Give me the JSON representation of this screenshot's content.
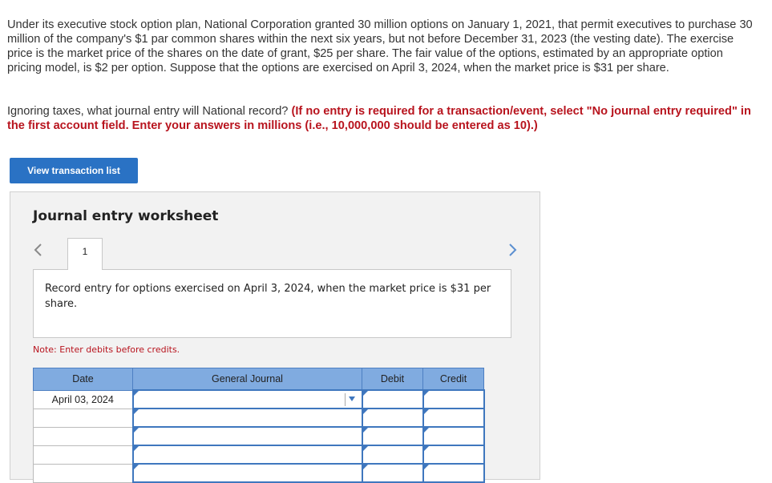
{
  "problem_text": "Under its executive stock option plan, National Corporation granted 30 million options on January 1, 2021, that permit executives to purchase 30 million of the company's $1 par common shares within the next six years, but not before December 31, 2023 (the vesting date). The exercise price is the market price of the shares on the date of grant, $25 per share. The fair value of the options, estimated by an appropriate option pricing model, is $2 per option. Suppose that the options are exercised on April 3, 2024, when the market price is $31 per share.",
  "instruction": {
    "question": "Ignoring taxes, what journal entry will National record?",
    "emphasis": "(If no entry is required for a transaction/event, select \"No journal entry required\" in the first account field. Enter your answers in millions (i.e., 10,000,000 should be entered as 10).)"
  },
  "buttons": {
    "view_transactions": "View transaction list"
  },
  "worksheet": {
    "title": "Journal entry worksheet",
    "tabs": [
      "1"
    ],
    "prompt": "Record entry for options exercised on April 3, 2024, when the market price is $31 per share.",
    "note": "Note: Enter debits before credits.",
    "columns": [
      "Date",
      "General Journal",
      "Debit",
      "Credit"
    ],
    "rows": [
      {
        "date": "April 03, 2024",
        "account": "",
        "debit": "",
        "credit": ""
      },
      {
        "date": "",
        "account": "",
        "debit": "",
        "credit": ""
      },
      {
        "date": "",
        "account": "",
        "debit": "",
        "credit": ""
      },
      {
        "date": "",
        "account": "",
        "debit": "",
        "credit": ""
      },
      {
        "date": "",
        "account": "",
        "debit": "",
        "credit": ""
      }
    ]
  },
  "icons": {
    "prev": "chevron-left-icon",
    "next": "chevron-right-icon",
    "dropdown": "caret-down-icon"
  },
  "colors": {
    "accent": "#2a72c4",
    "emphasis": "#b8141e",
    "table_header": "#80abe0",
    "input_border": "#3f77be"
  }
}
